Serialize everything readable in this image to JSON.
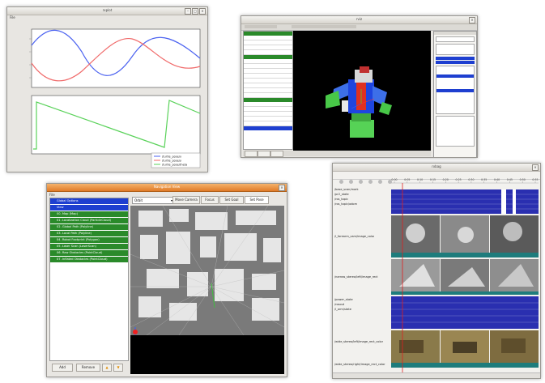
{
  "plot_window": {
    "title": "rxplot",
    "menu": "File",
    "legend": [
      "/turtle_pose/x",
      "/turtle_pose/y",
      "/turtle_pose/theta"
    ]
  },
  "rviz_window": {
    "title": "rviz"
  },
  "nav_window": {
    "title": "Navigation View",
    "menu": "File",
    "tree_items": [
      {
        "label": "Global Options",
        "color": "#1e3fd0"
      },
      {
        "label": "View",
        "color": "#1e3fd0"
      },
      {
        "label": "00. Map (Map)",
        "color": "#2a8a2a"
      },
      {
        "label": "01. Localization Cloud (ParticleCloud)",
        "color": "#2a8a2a"
      },
      {
        "label": "02. Global Path (Polyline)",
        "color": "#2a8a2a"
      },
      {
        "label": "03. Local Path (Polyline)",
        "color": "#2a8a2a"
      },
      {
        "label": "04. Robot Footprint (Polygon)",
        "color": "#2a8a2a"
      },
      {
        "label": "05. Laser Scan (LaserScan)",
        "color": "#2a8a2a"
      },
      {
        "label": "06. Raw Obstacles (PointCloud)",
        "color": "#2a8a2a"
      },
      {
        "label": "07. Inflated Obstacles (PointCloud)",
        "color": "#2a8a2a"
      }
    ],
    "view_select": "Orbit",
    "toolbar": [
      "Move Camera",
      "Focus",
      "Set Goal",
      "Set Pose"
    ],
    "add_label": "Add",
    "remove_label": "Remove"
  },
  "bag_window": {
    "title": "rxbag",
    "topics_top": [
      "/base_scan/mark",
      "/pr2_state",
      "/ros_topic",
      "/ros_topic/odom"
    ],
    "topic_image1": "/l_forearm_cam/image_color",
    "topic_image2": "/narrow_stereo/left/image_rect",
    "topics_mid": [
      "/power_state",
      "/rosout",
      "/l_arm/state"
    ],
    "topic_image3": "/wide_stereo/left/image_rect_color",
    "topic_image4": "/wide_stereo/right/image_rect_color",
    "ticks": [
      "0:00",
      "0:05",
      "0:10",
      "0:15",
      "0:20",
      "0:25",
      "0:30",
      "0:35",
      "0:40",
      "0:45",
      "0:50",
      "0:55"
    ]
  }
}
